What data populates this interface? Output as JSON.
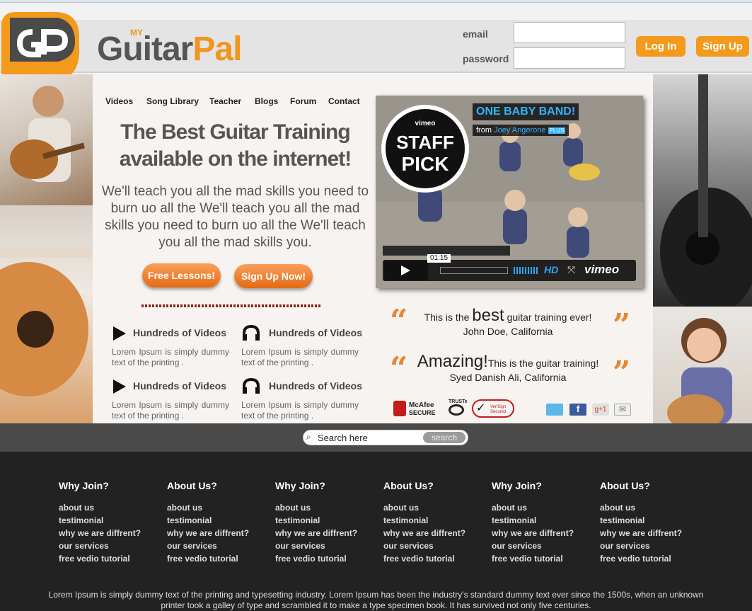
{
  "header": {
    "logo_my": "MY",
    "logo_guitar": "Guitar",
    "logo_pal": "Pal",
    "email_label": "email",
    "password_label": "password",
    "login_label": "Log In",
    "signup_label": "Sign Up",
    "accent": "#f39a1d"
  },
  "nav": [
    "Videos",
    "Song Library",
    "Teacher",
    "Blogs",
    "Forum",
    "Contact"
  ],
  "hero": {
    "title_line1": "The Best Guitar Training",
    "title_line2": "available on the internet!",
    "text": "We'll teach you all the mad skills you need to burn uo all the We'll teach you all the mad skills you need to burn uo all the We'll teach you all the mad skills you.",
    "btn_free": "Free Lessons!",
    "btn_signup": "Sign Up Now!"
  },
  "features": [
    {
      "icon": "play-icon",
      "title": "Hundreds of Videos",
      "text": "Lorem Ipsum is simply dummy text of the printing ."
    },
    {
      "icon": "headphones-icon",
      "title": "Hundreds of Videos",
      "text": "Lorem Ipsum is simply dummy text of the printing ."
    },
    {
      "icon": "play-icon",
      "title": "Hundreds of Videos",
      "text": "Lorem Ipsum is simply dummy text of the printing ."
    },
    {
      "icon": "headphones-icon",
      "title": "Hundreds of Videos",
      "text": "Lorem Ipsum is simply dummy text of the printing ."
    }
  ],
  "video": {
    "title": "ONE BABY BAND!",
    "from_label": "from",
    "author": "Joey Angerone",
    "plus": "PLUS",
    "badge_vimeo": "vimeo",
    "badge_line1": "STAFF",
    "badge_line2": "PICK",
    "time": "01:15",
    "hd": "HD",
    "brand": "vimeo"
  },
  "testimonials": [
    {
      "pre": "This is the",
      "big": "best",
      "post": "guitar training ever!",
      "author": "John Doe, California"
    },
    {
      "pre": "",
      "big": "Amazing!",
      "post": "This is the guitar training!",
      "author": "Syed Danish Ali, California"
    }
  ],
  "trust": {
    "mcafee": "McAfee",
    "mcafee_sub": "SECURE",
    "truste": "TRUSTe",
    "verisign": "VeriSign Secured"
  },
  "search": {
    "placeholder": "Search here",
    "button": "search"
  },
  "footer": {
    "columns": [
      {
        "title": "Why Join?",
        "links": [
          "about us",
          "testimonial",
          "why we are diffrent?",
          "our services",
          "free vedio tutorial"
        ]
      },
      {
        "title": "About Us?",
        "links": [
          "about us",
          "testimonial",
          "why we are diffrent?",
          "our services",
          "free vedio tutorial"
        ]
      },
      {
        "title": "Why Join?",
        "links": [
          "about us",
          "testimonial",
          "why we are diffrent?",
          "our services",
          "free vedio tutorial"
        ]
      },
      {
        "title": "About Us?",
        "links": [
          "about us",
          "testimonial",
          "why we are diffrent?",
          "our services",
          "free vedio tutorial"
        ]
      },
      {
        "title": "Why Join?",
        "links": [
          "about us",
          "testimonial",
          "why we are diffrent?",
          "our services",
          "free vedio tutorial"
        ]
      },
      {
        "title": "About Us?",
        "links": [
          "about us",
          "testimonial",
          "why we are diffrent?",
          "our services",
          "free vedio tutorial"
        ]
      }
    ],
    "note": "Lorem Ipsum is simply dummy text of the printing and typesetting industry. Lorem Ipsum has been the industry's standard dummy text ever since the 1500s, when an unknown printer took a galley of type and scrambled it to make a type specimen book. It has survived not only five centuries."
  }
}
